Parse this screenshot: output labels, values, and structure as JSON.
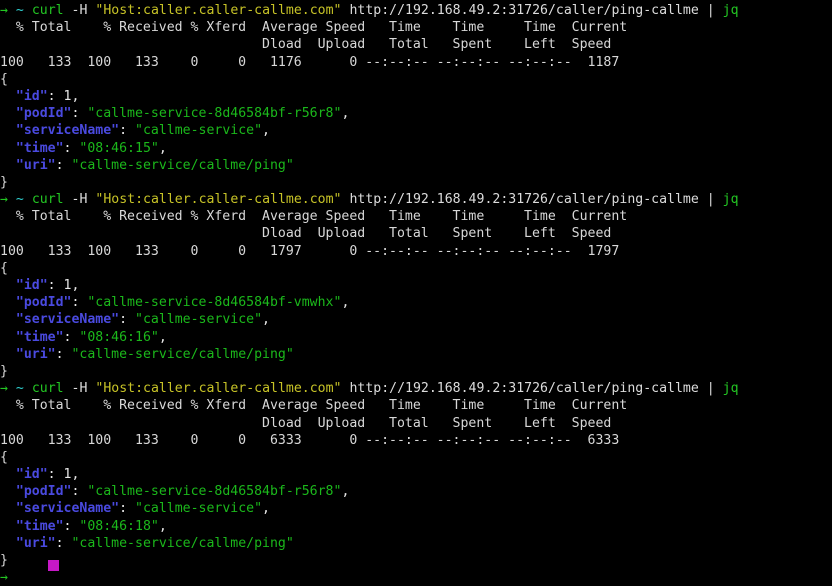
{
  "terminal": {
    "title": "terminal",
    "shell_symbol": "→",
    "cwd": "~",
    "cursor_color": "#c618c6",
    "background": "#000000",
    "foreground": "#d8d8d8",
    "colors": {
      "prompt_arrow": "#23c623",
      "cwd": "#2fd0d0",
      "command": "#23c623",
      "quoted_arg": "#c7c327",
      "plain": "#dcdcdc",
      "json_key": "#4a4ae0",
      "json_string": "#1bb81b"
    },
    "command": {
      "name": "curl",
      "flag": "-H",
      "header_arg": "\"Host:caller.caller-callme.com\"",
      "url": "http://192.168.49.2:31726/caller/ping-callme",
      "pipe": "|",
      "pipe_to": "jq"
    },
    "curl_header": {
      "row1": "  % Total    % Received % Xferd  Average Speed   Time    Time     Time  Current",
      "row2": "                                 Dload  Upload   Total   Spent    Left  Speed"
    },
    "blocks": [
      {
        "stats": "100   133  100   133    0     0   1176      0 --:--:-- --:--:-- --:--:--  1187",
        "json": {
          "open": "{",
          "close": "}",
          "fields": [
            {
              "key": "\"id\"",
              "sep": ": ",
              "value": "1",
              "value_type": "number",
              "comma": ","
            },
            {
              "key": "\"podId\"",
              "sep": ": ",
              "value": "\"callme-service-8d46584bf-r56r8\"",
              "value_type": "string",
              "comma": ","
            },
            {
              "key": "\"serviceName\"",
              "sep": ": ",
              "value": "\"callme-service\"",
              "value_type": "string",
              "comma": ","
            },
            {
              "key": "\"time\"",
              "sep": ": ",
              "value": "\"08:46:15\"",
              "value_type": "string",
              "comma": ","
            },
            {
              "key": "\"uri\"",
              "sep": ": ",
              "value": "\"callme-service/callme/ping\"",
              "value_type": "string",
              "comma": ""
            }
          ]
        }
      },
      {
        "stats": "100   133  100   133    0     0   1797      0 --:--:-- --:--:-- --:--:--  1797",
        "json": {
          "open": "{",
          "close": "}",
          "fields": [
            {
              "key": "\"id\"",
              "sep": ": ",
              "value": "1",
              "value_type": "number",
              "comma": ","
            },
            {
              "key": "\"podId\"",
              "sep": ": ",
              "value": "\"callme-service-8d46584bf-vmwhx\"",
              "value_type": "string",
              "comma": ","
            },
            {
              "key": "\"serviceName\"",
              "sep": ": ",
              "value": "\"callme-service\"",
              "value_type": "string",
              "comma": ","
            },
            {
              "key": "\"time\"",
              "sep": ": ",
              "value": "\"08:46:16\"",
              "value_type": "string",
              "comma": ","
            },
            {
              "key": "\"uri\"",
              "sep": ": ",
              "value": "\"callme-service/callme/ping\"",
              "value_type": "string",
              "comma": ""
            }
          ]
        }
      },
      {
        "stats": "100   133  100   133    0     0   6333      0 --:--:-- --:--:-- --:--:--  6333",
        "json": {
          "open": "{",
          "close": "}",
          "fields": [
            {
              "key": "\"id\"",
              "sep": ": ",
              "value": "1",
              "value_type": "number",
              "comma": ","
            },
            {
              "key": "\"podId\"",
              "sep": ": ",
              "value": "\"callme-service-8d46584bf-r56r8\"",
              "value_type": "string",
              "comma": ","
            },
            {
              "key": "\"serviceName\"",
              "sep": ": ",
              "value": "\"callme-service\"",
              "value_type": "string",
              "comma": ","
            },
            {
              "key": "\"time\"",
              "sep": ": ",
              "value": "\"08:46:18\"",
              "value_type": "string",
              "comma": ","
            },
            {
              "key": "\"uri\"",
              "sep": ": ",
              "value": "\"callme-service/callme/ping\"",
              "value_type": "string",
              "comma": ""
            }
          ]
        }
      }
    ],
    "final_prompt": {
      "shell_symbol": "→",
      "input": ""
    }
  }
}
